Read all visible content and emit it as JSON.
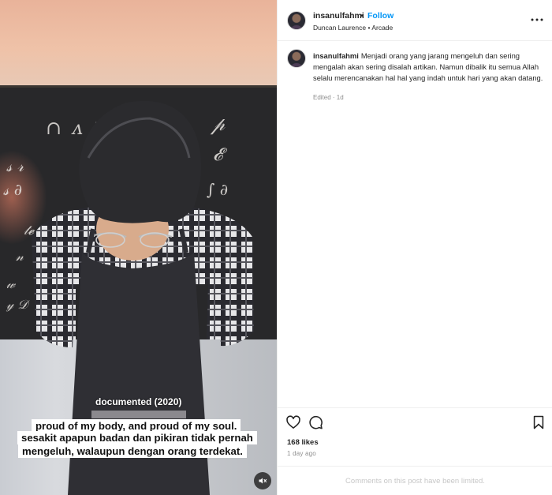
{
  "post": {
    "username": "insanulfahmi",
    "follow_label": "Follow",
    "separator": "•",
    "subtitle": "Duncan Laurence • Arcade",
    "more_icon": "more-horizontal-icon"
  },
  "media": {
    "tag": "documented (2020)",
    "caption_lines": [
      "proud of my body, and proud of my soul.",
      "sesakit apapun badan dan pikiran tidak pernah",
      "mengeluh, walaupun dengan orang terdekat."
    ],
    "mute_icon": "muted-speaker-icon"
  },
  "caption": {
    "username": "insanulfahmi",
    "text": "Menjadi orang yang jarang mengeluh dan sering mengalah akan sering disalah artikan. Namun dibalik itu semua Allah selalu merencanakan hal hal yang indah untuk hari yang akan datang.",
    "meta": "Edited · 1d"
  },
  "actions": {
    "likes": "168 likes",
    "time_ago": "1 day ago",
    "comments_limited": "Comments on this post have been limited."
  },
  "colors": {
    "accent": "#0095f6",
    "muted_text": "#8e8e8e",
    "divider": "#efefef"
  }
}
